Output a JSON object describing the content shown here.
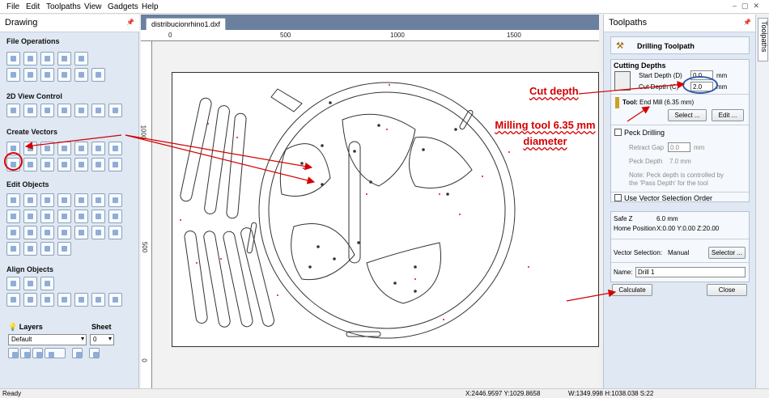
{
  "menu": [
    "File",
    "Edit",
    "Toolpaths",
    "View",
    "Gadgets",
    "Help"
  ],
  "left_panel": {
    "title": "Drawing",
    "sections": {
      "file_ops": "File Operations",
      "view_control": "2D View Control",
      "create_vectors": "Create Vectors",
      "edit_objects": "Edit Objects",
      "align_objects": "Align Objects"
    },
    "layers_label": "Layers",
    "sheet_label": "Sheet",
    "layer_value": "Default",
    "sheet_value": "0"
  },
  "document": {
    "tab": "distribucionrhino1.dxf",
    "h_ruler": [
      "0",
      "500",
      "1000",
      "1500"
    ],
    "v_ruler": [
      "1000",
      "500",
      "0"
    ]
  },
  "toolpaths": {
    "panel_title": "Toolpaths",
    "side_tab": "Toolpaths",
    "header": "Drilling Toolpath",
    "cut_depths_title": "Cutting Depths",
    "start_depth_label": "Start Depth (D)",
    "start_depth_value": "0.0",
    "cut_depth_label": "Cut Depth (C)",
    "cut_depth_value": "2.0",
    "unit": "mm",
    "tool_label": "Tool:",
    "tool_value": "End Mill (6.35 mm)",
    "select_button": "Select ...",
    "edit_button": "Edit ...",
    "peck_label": "Peck Drilling",
    "retract_label": "Retract Gap",
    "retract_value": "0.0",
    "peck_depth_label": "Peck Depth",
    "peck_depth_value": "7.0 mm",
    "note": "Note: Peck depth is controlled by the 'Pass Depth' for the tool",
    "vector_order_label": "Use Vector Selection Order",
    "safe_z_label": "Safe Z",
    "safe_z_value": "6.0 mm",
    "home_label": "Home Position",
    "home_value": "X:0.00 Y:0.00 Z:20.00",
    "vec_sel_label": "Vector Selection:",
    "vec_sel_value": "Manual",
    "selector_button": "Selector ...",
    "name_label": "Name:",
    "name_value": "Drill 1",
    "calculate_button": "Calculate",
    "close_button": "Close"
  },
  "annotations": {
    "cut_depth": "Cut depth",
    "milling_tool": "Milling tool 6.35 mm diameter"
  },
  "status": {
    "left": "Ready",
    "coords": "X:2446.9597 Y:1029.8658",
    "size": "W:1349.998  H:1038.038  S:22"
  },
  "colors": {
    "annotation": "#d40000",
    "panel": "#dfe8f3",
    "canvas_bg": "#6b7f9e"
  }
}
